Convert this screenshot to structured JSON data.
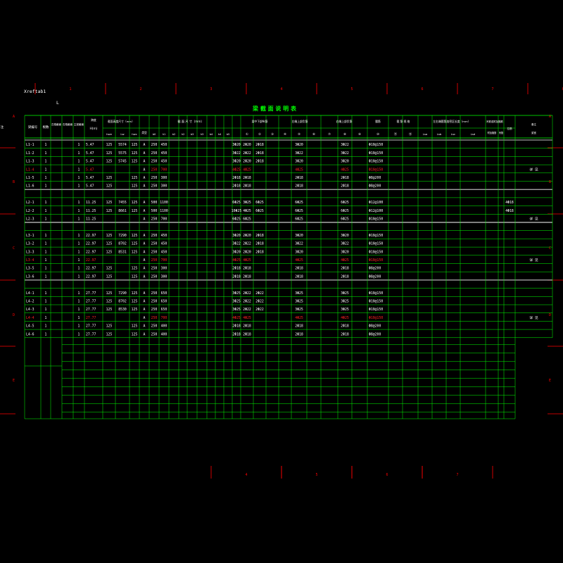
{
  "drawing": {
    "xref_label": "Xreftab1",
    "corner_mark": "L",
    "title": "梁 截 面 说 明 表"
  },
  "colors": {
    "background": "#000000",
    "grid": "#00ff00",
    "frame": "#ff0000",
    "text": "#ffffff",
    "highlight": "#ff2020",
    "title": "#00ff00"
  },
  "column_markers_top": [
    "1",
    "2",
    "3",
    "4",
    "5",
    "6",
    "7",
    "8"
  ],
  "column_markers_bottom": [
    "4",
    "5",
    "6",
    "7"
  ],
  "row_markers": [
    "A",
    "B",
    "C",
    "D",
    "E"
  ],
  "headers": {
    "c1": "梁编号",
    "c2": "根数",
    "c3": "左端截面",
    "c4": "右端截面",
    "c5": "主梁截面",
    "c6": "跨度",
    "c7": "H(m)",
    "c8_group": "截面高度尺寸（mm）",
    "c8_sub": [
      "hwe",
      "Lw",
      "hwc"
    ],
    "c11": "类型",
    "c12_group": "截 面 尺 寸（mm）",
    "c12_sub": [
      "b0",
      "h1",
      "b2",
      "h2",
      "b3",
      "h3",
      "b4",
      "h4",
      "b5"
    ],
    "c21_group": "梁中下部纵筋",
    "c21_sub": [
      "①",
      "②",
      "③"
    ],
    "c24_group": "左端上部负筋",
    "c24_sub": [
      "④",
      "⑤",
      "⑥"
    ],
    "c27_group": "右端上部负筋",
    "c27_sub": [
      "⑦",
      "⑧",
      "⑨"
    ],
    "c30_group": "腰筋",
    "c30_sub": [
      "⑩"
    ],
    "c31_group": "箍 筋 规 格",
    "c31_sub": [
      "⑪",
      "⑫"
    ],
    "c33_group": "左右端箍筋加密区长度（mm）",
    "c33_sub": [
      "Lsa",
      "Lsb",
      "Lsc",
      "Lsd"
    ],
    "c37_group": "吊筋或附加箍筋",
    "c37_sub": [
      "附加箍筋",
      "吊筋"
    ],
    "c39": "拉筋",
    "c40": "备注",
    "c40b": "梁宽",
    "c41": "备 注"
  },
  "rows": [
    {
      "id": "L1-1",
      "n": "1",
      "t": "1",
      "span": "5.47",
      "a": "125",
      "b": "5574",
      "c": "125",
      "type": "A",
      "b0": "250",
      "h1": "450",
      "r1": "3Φ20",
      "r2": "2Φ20",
      "r3": "2Φ18",
      "r4": "3Φ20",
      "r5": "3Φ22",
      "r6": "Φ10@150",
      "g": "",
      "note": "",
      "hl": false
    },
    {
      "id": "L1-2",
      "n": "1",
      "t": "1",
      "span": "5.47",
      "a": "125",
      "b": "5575",
      "c": "125",
      "type": "A",
      "b0": "250",
      "h1": "450",
      "r1": "3Φ22",
      "r2": "2Φ22",
      "r3": "2Φ18",
      "r4": "3Φ22",
      "r5": "3Φ22",
      "r6": "Φ10@150",
      "g": "",
      "note": "",
      "hl": false
    },
    {
      "id": "L1-3",
      "n": "1",
      "t": "1",
      "span": "5.47",
      "a": "125",
      "b": "5745",
      "c": "125",
      "type": "A",
      "b0": "250",
      "h1": "450",
      "r1": "3Φ20",
      "r2": "2Φ20",
      "r3": "2Φ18",
      "r4": "3Φ20",
      "r5": "3Φ20",
      "r6": "Φ10@150",
      "g": "",
      "note": "",
      "hl": false
    },
    {
      "id": "L1-4",
      "n": "1",
      "t": "1",
      "span": "5.47",
      "a": "",
      "b": "",
      "c": "",
      "type": "A",
      "b0": "250",
      "h1": "700",
      "r1": "4Φ25",
      "r2": "4Φ25",
      "r3": "",
      "r4": "4Φ25",
      "r5": "4Φ25",
      "r6": "Φ10@150",
      "g": "",
      "note": "详 见",
      "hl": true
    },
    {
      "id": "L1-5",
      "n": "1",
      "t": "1",
      "span": "5.47",
      "a": "125",
      "b": "",
      "c": "125",
      "type": "A",
      "b0": "250",
      "h1": "300",
      "r1": "2Φ18",
      "r2": "2Φ18",
      "r3": "",
      "r4": "2Φ18",
      "r5": "2Φ18",
      "r6": "Φ8@200",
      "g": "",
      "note": "",
      "hl": false
    },
    {
      "id": "L1-6",
      "n": "1",
      "t": "1",
      "span": "5.47",
      "a": "125",
      "b": "",
      "c": "125",
      "type": "A",
      "b0": "250",
      "h1": "300",
      "r1": "2Φ18",
      "r2": "2Φ18",
      "r3": "",
      "r4": "2Φ18",
      "r5": "2Φ18",
      "r6": "Φ8@200",
      "g": "",
      "note": "",
      "hl": false
    },
    {
      "id": "",
      "n": "",
      "t": "",
      "span": "",
      "a": "",
      "b": "",
      "c": "",
      "type": "",
      "b0": "",
      "h1": "",
      "r1": "",
      "r2": "",
      "r3": "",
      "r4": "",
      "r5": "",
      "r6": "",
      "g": "",
      "note": "",
      "hl": false
    },
    {
      "id": "L2-1",
      "n": "1",
      "t": "1",
      "span": "11.25",
      "a": "125",
      "b": "7455",
      "c": "125",
      "type": "A",
      "b0": "500",
      "h1": "1100",
      "r1": "6Φ25",
      "r2": "3Φ25",
      "r3": "6Φ25",
      "r4": "6Φ25",
      "r5": "6Φ25",
      "r6": "Φ12@100",
      "g": "4Φ18",
      "note": "",
      "hl": false
    },
    {
      "id": "L2-2",
      "n": "1",
      "t": "1",
      "span": "11.25",
      "a": "125",
      "b": "8661",
      "c": "125",
      "type": "A",
      "b0": "500",
      "h1": "1100",
      "r1": "10Φ25",
      "r2": "4Φ25",
      "r3": "6Φ25",
      "r4": "6Φ25",
      "r5": "6Φ25",
      "r6": "Φ12@100",
      "g": "4Φ18",
      "note": "",
      "hl": false
    },
    {
      "id": "L2-3",
      "n": "1",
      "t": "1",
      "span": "11.25",
      "a": "",
      "b": "",
      "c": "",
      "type": "A",
      "b0": "250",
      "h1": "700",
      "r1": "6Φ25",
      "r2": "6Φ25",
      "r3": "",
      "r4": "6Φ25",
      "r5": "6Φ25",
      "r6": "Φ10@150",
      "g": "",
      "note": "详 见",
      "hl": false
    },
    {
      "id": "",
      "n": "",
      "t": "",
      "span": "",
      "a": "",
      "b": "",
      "c": "",
      "type": "",
      "b0": "",
      "h1": "",
      "r1": "",
      "r2": "",
      "r3": "",
      "r4": "",
      "r5": "",
      "r6": "",
      "g": "",
      "note": "",
      "hl": false
    },
    {
      "id": "L3-1",
      "n": "1",
      "t": "1",
      "span": "22.97",
      "a": "125",
      "b": "7290",
      "c": "125",
      "type": "A",
      "b0": "250",
      "h1": "450",
      "r1": "3Φ20",
      "r2": "2Φ20",
      "r3": "2Φ18",
      "r4": "3Φ20",
      "r5": "3Φ20",
      "r6": "Φ10@150",
      "g": "",
      "note": "",
      "hl": false
    },
    {
      "id": "L3-2",
      "n": "1",
      "t": "1",
      "span": "22.97",
      "a": "125",
      "b": "8702",
      "c": "125",
      "type": "A",
      "b0": "250",
      "h1": "450",
      "r1": "3Φ22",
      "r2": "2Φ22",
      "r3": "2Φ18",
      "r4": "3Φ22",
      "r5": "3Φ22",
      "r6": "Φ10@150",
      "g": "",
      "note": "",
      "hl": false
    },
    {
      "id": "L3-3",
      "n": "1",
      "t": "1",
      "span": "22.97",
      "a": "125",
      "b": "8531",
      "c": "125",
      "type": "A",
      "b0": "250",
      "h1": "450",
      "r1": "3Φ20",
      "r2": "2Φ20",
      "r3": "2Φ18",
      "r4": "3Φ20",
      "r5": "3Φ20",
      "r6": "Φ10@150",
      "g": "",
      "note": "",
      "hl": false
    },
    {
      "id": "L3-4",
      "n": "1",
      "t": "1",
      "span": "22.97",
      "a": "",
      "b": "",
      "c": "",
      "type": "A",
      "b0": "250",
      "h1": "700",
      "r1": "4Φ25",
      "r2": "4Φ25",
      "r3": "",
      "r4": "4Φ25",
      "r5": "4Φ25",
      "r6": "Φ10@150",
      "g": "",
      "note": "详 见",
      "hl": true
    },
    {
      "id": "L3-5",
      "n": "1",
      "t": "1",
      "span": "22.97",
      "a": "125",
      "b": "",
      "c": "125",
      "type": "A",
      "b0": "250",
      "h1": "300",
      "r1": "2Φ18",
      "r2": "2Φ18",
      "r3": "",
      "r4": "2Φ18",
      "r5": "2Φ18",
      "r6": "Φ8@200",
      "g": "",
      "note": "",
      "hl": false
    },
    {
      "id": "L3-6",
      "n": "1",
      "t": "1",
      "span": "22.97",
      "a": "125",
      "b": "",
      "c": "125",
      "type": "A",
      "b0": "250",
      "h1": "300",
      "r1": "2Φ18",
      "r2": "2Φ18",
      "r3": "",
      "r4": "2Φ18",
      "r5": "2Φ18",
      "r6": "Φ8@200",
      "g": "",
      "note": "",
      "hl": false
    },
    {
      "id": "",
      "n": "",
      "t": "",
      "span": "",
      "a": "",
      "b": "",
      "c": "",
      "type": "",
      "b0": "",
      "h1": "",
      "r1": "",
      "r2": "",
      "r3": "",
      "r4": "",
      "r5": "",
      "r6": "",
      "g": "",
      "note": "",
      "hl": false
    },
    {
      "id": "L4-1",
      "n": "1",
      "t": "1",
      "span": "27.77",
      "a": "125",
      "b": "7290",
      "c": "125",
      "type": "A",
      "b0": "250",
      "h1": "650",
      "r1": "3Φ25",
      "r2": "2Φ22",
      "r3": "2Φ22",
      "r4": "3Φ25",
      "r5": "3Φ25",
      "r6": "Φ10@150",
      "g": "",
      "note": "",
      "hl": false
    },
    {
      "id": "L4-2",
      "n": "1",
      "t": "1",
      "span": "27.77",
      "a": "125",
      "b": "8702",
      "c": "125",
      "type": "A",
      "b0": "250",
      "h1": "650",
      "r1": "3Φ25",
      "r2": "2Φ22",
      "r3": "2Φ22",
      "r4": "3Φ25",
      "r5": "3Φ25",
      "r6": "Φ10@150",
      "g": "",
      "note": "",
      "hl": false
    },
    {
      "id": "L4-3",
      "n": "1",
      "t": "1",
      "span": "27.77",
      "a": "125",
      "b": "8530",
      "c": "125",
      "type": "A",
      "b0": "250",
      "h1": "650",
      "r1": "3Φ25",
      "r2": "2Φ22",
      "r3": "2Φ22",
      "r4": "3Φ25",
      "r5": "3Φ25",
      "r6": "Φ10@150",
      "g": "",
      "note": "",
      "hl": false
    },
    {
      "id": "L4-4",
      "n": "1",
      "t": "1",
      "span": "27.77",
      "a": "",
      "b": "",
      "c": "",
      "type": "A",
      "b0": "250",
      "h1": "700",
      "r1": "4Φ25",
      "r2": "4Φ25",
      "r3": "",
      "r4": "4Φ25",
      "r5": "4Φ25",
      "r6": "Φ10@150",
      "g": "",
      "note": "详 见",
      "hl": true
    },
    {
      "id": "L4-5",
      "n": "1",
      "t": "1",
      "span": "27.77",
      "a": "125",
      "b": "",
      "c": "125",
      "type": "A",
      "b0": "250",
      "h1": "400",
      "r1": "2Φ18",
      "r2": "2Φ18",
      "r3": "",
      "r4": "2Φ18",
      "r5": "2Φ18",
      "r6": "Φ8@200",
      "g": "",
      "note": "",
      "hl": false
    },
    {
      "id": "L4-6",
      "n": "1",
      "t": "1",
      "span": "27.77",
      "a": "125",
      "b": "",
      "c": "125",
      "type": "A",
      "b0": "250",
      "h1": "400",
      "r1": "2Φ18",
      "r2": "2Φ18",
      "r3": "",
      "r4": "2Φ18",
      "r5": "2Φ18",
      "r6": "Φ8@200",
      "g": "",
      "note": "",
      "hl": false
    }
  ]
}
